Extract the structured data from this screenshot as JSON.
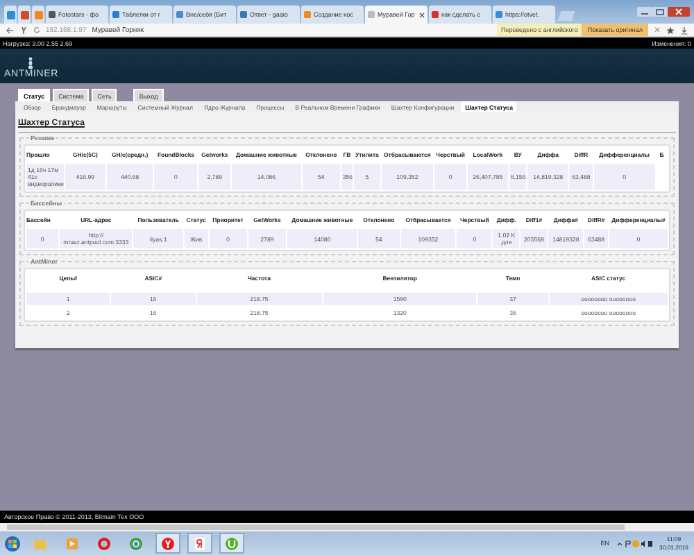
{
  "browser": {
    "tabs": [
      {
        "kind": "pinned",
        "color": "#2a8fd8",
        "selected": false
      },
      {
        "kind": "pinned",
        "color": "#d84a2a",
        "selected": false
      },
      {
        "kind": "pinned",
        "color": "#f08a20",
        "selected": false
      },
      {
        "title": "Fotostars - фо",
        "kind": "page",
        "color": "#555555",
        "selected": false
      },
      {
        "title": "Таблетки от г",
        "kind": "page",
        "color": "#2a7ad8",
        "selected": false
      },
      {
        "title": "Вне/себя (Бит",
        "kind": "page",
        "color": "#4a8ad0",
        "selected": false
      },
      {
        "title": "Ответ - gaaio",
        "kind": "page",
        "color": "#3a7ab0",
        "selected": false
      },
      {
        "title": "Создание кос",
        "kind": "page",
        "color": "#f08a20",
        "selected": false
      },
      {
        "title": "Муравей Гор",
        "kind": "page",
        "color": "#bbbbbb",
        "selected": true
      },
      {
        "title": "как сделать с",
        "kind": "page",
        "color": "#d83030",
        "selected": false
      },
      {
        "title": "https://otvet.",
        "kind": "page",
        "color": "#3a8ae0",
        "selected": false
      }
    ],
    "address": "192.168.1.97",
    "page_title": "Муравей Горняк",
    "translate_notice": "Переведено с английского",
    "translate_button": "Показать оригинал"
  },
  "status_bar": {
    "load": "Нагрузка: 3.00 2.55 2.69",
    "changes": "Изменения: 0"
  },
  "logo": "ANTMINER",
  "main_tabs": [
    {
      "label": "Статус",
      "selected": true
    },
    {
      "label": "Система",
      "selected": false
    },
    {
      "label": "Сеть",
      "selected": false
    },
    {
      "label": "Выход",
      "selected": false
    }
  ],
  "sub_tabs": [
    {
      "label": "Обзор",
      "selected": false
    },
    {
      "label": "Брандмауэр",
      "selected": false
    },
    {
      "label": "Маршруты",
      "selected": false
    },
    {
      "label": "Системный Журнал",
      "selected": false
    },
    {
      "label": "Ядро Журнала",
      "selected": false
    },
    {
      "label": "Процессы",
      "selected": false
    },
    {
      "label": "В Реальном Времени Графики",
      "selected": false
    },
    {
      "label": "Шахтер Конфигурации",
      "selected": false
    },
    {
      "label": "Шахтер Статуса",
      "selected": true
    }
  ],
  "page_heading": "Шахтер Статуса",
  "sections": [
    {
      "kind": "summary",
      "legend": "Резюме",
      "columns": [
        "Прошло",
        "GH/с(5С)",
        "GH/с(средн.)",
        "FoundBlocks",
        "Getworks",
        "Домашние животные",
        "Отклонено",
        "ГВ",
        "Утилита",
        "Отбрасываются",
        "Черствый",
        "LocalWork",
        "ВУ",
        "Диффа",
        "DiffR",
        "Дифференциалы",
        "Б"
      ],
      "rows": [
        [
          "1д 16ч 17м 41с видеоролики",
          "416.99",
          "440.68",
          "0",
          "2,789",
          "14,086",
          "54",
          "356",
          "5",
          "109,352",
          "0",
          "26,407,785",
          "6,156",
          "14,819,328",
          "63,488",
          "0"
        ]
      ]
    },
    {
      "kind": "pools",
      "legend": "Бассейны",
      "columns": [
        "Бассейн",
        "URL-адрес",
        "Пользователь",
        "Статус",
        "Приоритет",
        "GetWorks",
        "Домашние животные",
        "Отклонено",
        "Отбрасывается",
        "Черствый",
        "Дифф.",
        "Diff1#",
        "Диффа#",
        "DiffR#",
        "Дифференциалы#"
      ],
      "rows": [
        [
          "0",
          "http:// mnacr.antpool.com:3333",
          "ilyas.1",
          "Жив",
          "0",
          "2789",
          "14086",
          "54",
          "109352",
          "0",
          "1.02 K для",
          "203568",
          "14819328",
          "63488",
          "0"
        ]
      ]
    },
    {
      "kind": "chains",
      "legend": "AntMiner",
      "columns": [
        "Цепь#",
        "ASIC#",
        "Частота",
        "Вентилятор",
        "Темп",
        "ASIC статус"
      ],
      "rows": [
        [
          "1",
          "16",
          "218.75",
          "1590",
          "37",
          "oooooooo oooooooo"
        ],
        [
          "2",
          "16",
          "218.75",
          "1320",
          "36",
          "oooooooo oooooooo"
        ]
      ]
    }
  ],
  "footer": "Авторское Право © 2011-2013, Bitmain Тех ООО",
  "taskbar": {
    "apps": [
      {
        "kind": "folder",
        "open": false
      },
      {
        "kind": "media",
        "open": false
      },
      {
        "kind": "opera",
        "open": false
      },
      {
        "kind": "chrome",
        "open": false
      },
      {
        "kind": "yandex",
        "open": true
      },
      {
        "kind": "ya",
        "open": true
      },
      {
        "kind": "torrent",
        "open": true
      }
    ],
    "language": "EN",
    "time": "11:09",
    "date": "30.01.2016"
  }
}
